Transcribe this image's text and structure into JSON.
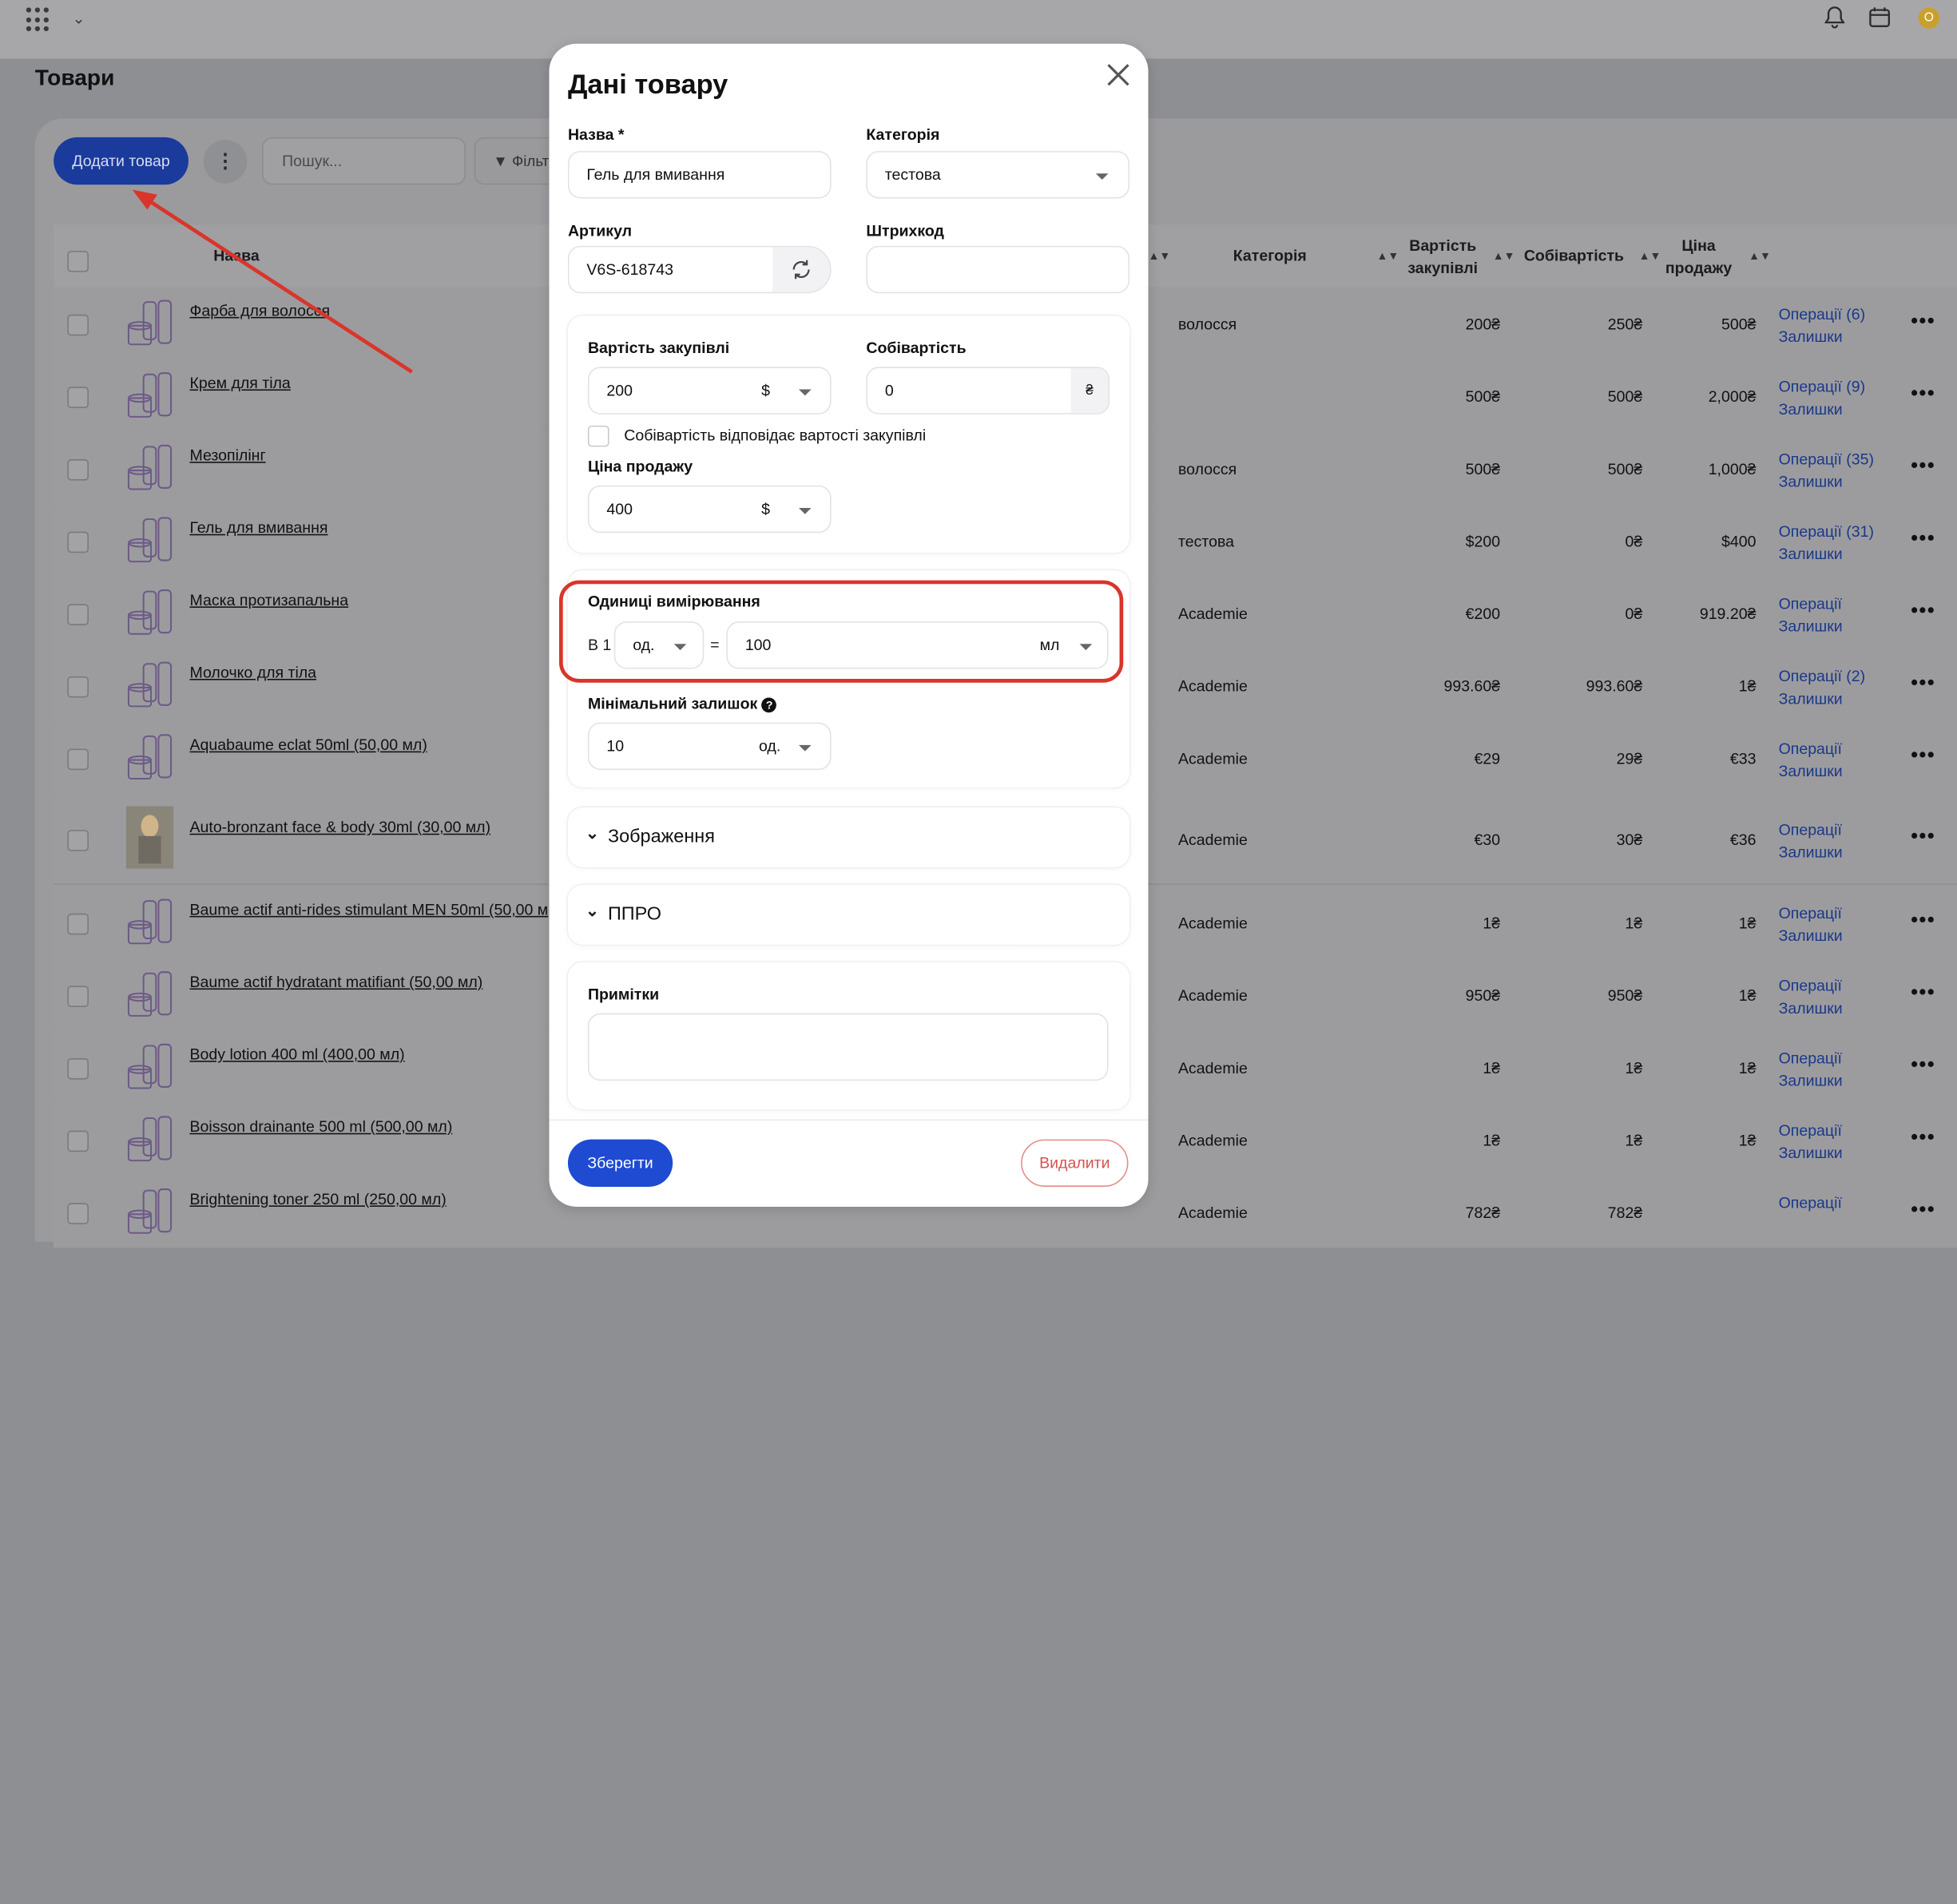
{
  "header": {
    "avatar_initial": "O"
  },
  "page": {
    "title": "Товари"
  },
  "toolbar": {
    "add_label": "Додати товар",
    "more_label": "⋮",
    "search_placeholder": "Пошук...",
    "filter_label": "Фільт"
  },
  "table": {
    "headers": {
      "name": "Назва",
      "category": "Категорія",
      "purchase_cost": "Вартість закупівлі",
      "cost": "Собівартість",
      "sale_price": "Ціна продажу"
    },
    "rows": [
      {
        "name": "Фарба для волосся",
        "category": "волосся",
        "purchase": "200₴",
        "cost": "250₴",
        "price": "500₴",
        "ops": "Операції (6)",
        "stock": "Залишки"
      },
      {
        "name": "Крем для тіла",
        "category": "",
        "purchase": "500₴",
        "cost": "500₴",
        "price": "2,000₴",
        "ops": "Операції (9)",
        "stock": "Залишки"
      },
      {
        "name": "Мезопілінг",
        "category": "волосся",
        "purchase": "500₴",
        "cost": "500₴",
        "price": "1,000₴",
        "ops": "Операції (35)",
        "stock": "Залишки"
      },
      {
        "name": "Гель для вмивання",
        "category": "тестова",
        "purchase": "$200",
        "cost": "0₴",
        "price": "$400",
        "ops": "Операції (31)",
        "stock": "Залишки"
      },
      {
        "name": "Маска протизапальна",
        "category": "Academie",
        "purchase": "€200",
        "cost": "0₴",
        "price": "919.20₴",
        "ops": "Операції",
        "stock": "Залишки"
      },
      {
        "name": "Молочко для тіла",
        "category": "Academie",
        "purchase": "993.60₴",
        "cost": "993.60₴",
        "price": "1₴",
        "ops": "Операції (2)",
        "stock": "Залишки"
      },
      {
        "name": "Aquabaume eclat 50ml (50,00 мл)",
        "category": "Academie",
        "purchase": "€29",
        "cost": "29₴",
        "price": "€33",
        "ops": "Операції",
        "stock": "Залишки"
      },
      {
        "name": "Auto-bronzant face & body 30ml (30,00 мл)",
        "category": "Academie",
        "purchase": "€30",
        "cost": "30₴",
        "price": "€36",
        "ops": "Операції",
        "stock": "Залишки"
      },
      {
        "name": "Baume actif anti-rides stimulant MEN 50ml (50,00 м",
        "category": "Academie",
        "purchase": "1₴",
        "cost": "1₴",
        "price": "1₴",
        "ops": "Операції",
        "stock": "Залишки"
      },
      {
        "name": "Baume actif hydratant matifiant (50,00 мл)",
        "category": "Academie",
        "purchase": "950₴",
        "cost": "950₴",
        "price": "1₴",
        "ops": "Операції",
        "stock": "Залишки"
      },
      {
        "name": "Body lotion 400 ml (400,00 мл)",
        "category": "Academie",
        "purchase": "1₴",
        "cost": "1₴",
        "price": "1₴",
        "ops": "Операції",
        "stock": "Залишки"
      },
      {
        "name": "Boisson drainante 500 ml (500,00 мл)",
        "category": "Academie",
        "purchase": "1₴",
        "cost": "1₴",
        "price": "1₴",
        "ops": "Операції",
        "stock": "Залишки"
      },
      {
        "name": "Brightening toner 250 ml (250,00 мл)",
        "category": "Academie",
        "purchase": "782₴",
        "cost": "782₴",
        "price": "",
        "ops": "Операції",
        "stock": ""
      }
    ]
  },
  "modal": {
    "title": "Дані товару",
    "name_label": "Назва *",
    "name_value": "Гель для вмивання",
    "category_label": "Категорія",
    "category_value": "тестова",
    "sku_label": "Артикул",
    "sku_value": "V6S-618743",
    "barcode_label": "Штрихкод",
    "barcode_value": "",
    "purchase_label": "Вартість закупівлі",
    "purchase_value": "200",
    "purchase_currency": "$",
    "cost_label": "Собівартість",
    "cost_value": "0",
    "cost_currency": "₴",
    "same_cost_label": "Собівартість відповідає вартості закупівлі",
    "price_label": "Ціна продажу",
    "price_value": "400",
    "price_currency": "$",
    "units_label": "Одиниці вимірювання",
    "units_prefix": "В 1",
    "units_unit": "од.",
    "units_eq": "=",
    "units_amount": "100",
    "units_measure": "мл",
    "min_stock_label": "Мінімальний залишок",
    "min_stock_value": "10",
    "min_stock_unit": "од.",
    "images_label": "Зображення",
    "ppro_label": "ППРО",
    "notes_label": "Примітки",
    "notes_value": "",
    "save_label": "Зберегти",
    "delete_label": "Видалити"
  },
  "colors": {
    "accent": "#1e4bd2",
    "highlight": "#d9352a",
    "delete": "#d65252",
    "link": "#1a3888"
  }
}
